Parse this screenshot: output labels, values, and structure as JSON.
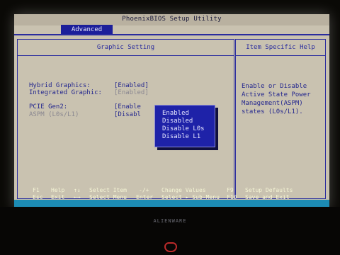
{
  "bios": {
    "title": "PhoenixBIOS Setup Utility",
    "active_tab": "Advanced"
  },
  "left_panel": {
    "heading": "Graphic Setting",
    "settings": [
      {
        "label": "Hybrid Graphics:",
        "value": "[Enabled]"
      },
      {
        "label": "Integrated Graphic:",
        "value": "[Enabled]"
      },
      {
        "label": "PCIE Gen2:",
        "value": "[Enable"
      },
      {
        "label": "ASPM (L0s/L1)",
        "value": "[Disabl"
      }
    ]
  },
  "right_panel": {
    "heading": "Item Specific Help",
    "help_lines": [
      "Enable or Disable",
      "Active State Power",
      "Management(ASPM)",
      "states (L0s/L1)."
    ]
  },
  "dropdown": {
    "options": [
      "Enabled",
      "Disabled",
      "Disable L0s",
      "Disable L1"
    ]
  },
  "footer": {
    "row1": [
      "F1",
      "Help",
      "↑↓",
      "Select Item",
      "-/+",
      "Change Values",
      "F9",
      "Setup Defaults"
    ],
    "row2": [
      "Esc",
      "Exit",
      "←→",
      "Select Menu",
      "Enter",
      "Select ▸ Sub-Menu",
      "F10",
      "Save and Exit"
    ]
  },
  "bezel": {
    "brand": "ALIENWARE"
  },
  "colors": {
    "screen_bg": "#c9c2b0",
    "accent_blue": "#2a2c9e",
    "footer_bg": "#1c8bb4",
    "dropdown_bg": "#1e22a8"
  }
}
